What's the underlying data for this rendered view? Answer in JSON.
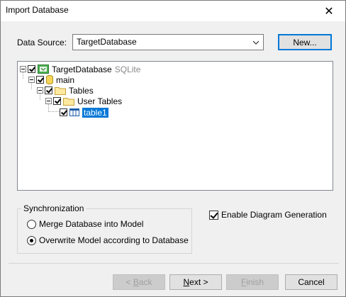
{
  "window": {
    "title": "Import Database",
    "close_glyph": "✕"
  },
  "data_source": {
    "label": "Data Source:",
    "value": "TargetDatabase",
    "new_button": "New..."
  },
  "tree": {
    "root": {
      "label": "TargetDatabase",
      "sublabel": "SQLite"
    },
    "schema": {
      "label": "main"
    },
    "folder": {
      "label": "Tables"
    },
    "subfolder": {
      "label": "User Tables"
    },
    "table": {
      "label": "table1"
    }
  },
  "sync": {
    "title": "Synchronization",
    "option1": "Merge Database into Model",
    "option2": "Overwrite Model according to Database",
    "selected": 2
  },
  "enable_diagram": {
    "label": "Enable Diagram Generation",
    "checked": true
  },
  "buttons": {
    "back_prefix": "< ",
    "back_key": "B",
    "back_rest": "ack",
    "next_key": "N",
    "next_rest": "ext >",
    "finish_key": "F",
    "finish_rest": "inish",
    "cancel": "Cancel"
  },
  "colors": {
    "selection": "#0078d7",
    "focus_border": "#0078d7",
    "dialog_bg": "#f0f0f0"
  }
}
